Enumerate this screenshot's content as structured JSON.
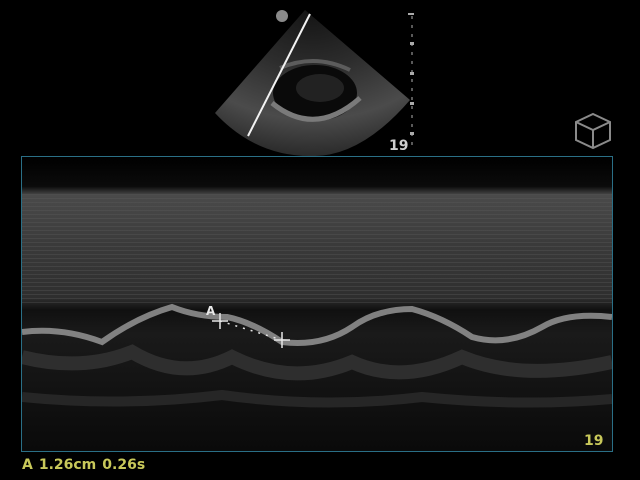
{
  "sector": {
    "frame_label": "19"
  },
  "mmode": {
    "frame_label": "19"
  },
  "caliper": {
    "label": "A"
  },
  "measurement": {
    "label": "A",
    "distance": "1.26cm",
    "time": "0.26s"
  },
  "colors": {
    "measurement_text": "#c8c85a",
    "panel_border": "#2a6f86"
  },
  "icons": {
    "view_icon": "cube-icon",
    "probe_marker": "probe-dot-icon"
  }
}
